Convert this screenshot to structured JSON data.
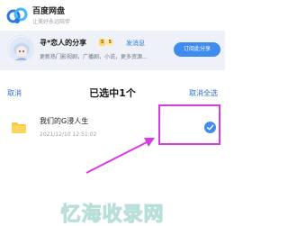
{
  "header": {
    "title": "百度网盘",
    "slogan": "让美好永远陪伴",
    "logo_icon": "baidu-netdisk-logo"
  },
  "share_card": {
    "title": "寻*恋人的分享",
    "level_badges": [
      "5",
      "5"
    ],
    "link_label": "发消息",
    "description": "更新热门影视剧，广播剧，小说，更多资源...",
    "subscribe_label": "订阅此分享",
    "accent_color": "#3f8cf0"
  },
  "selection_bar": {
    "cancel_label": "取消",
    "selected_text": "已选中1个",
    "deselect_all_label": "取消全选"
  },
  "files": [
    {
      "icon": "folder-icon",
      "name": "我们的G浸人生",
      "date": "2021/12/10 12:51:02",
      "checked": true
    }
  ],
  "annotation": {
    "highlight_color": "#d83ae3"
  },
  "watermark": {
    "text": "忆海收录网"
  }
}
